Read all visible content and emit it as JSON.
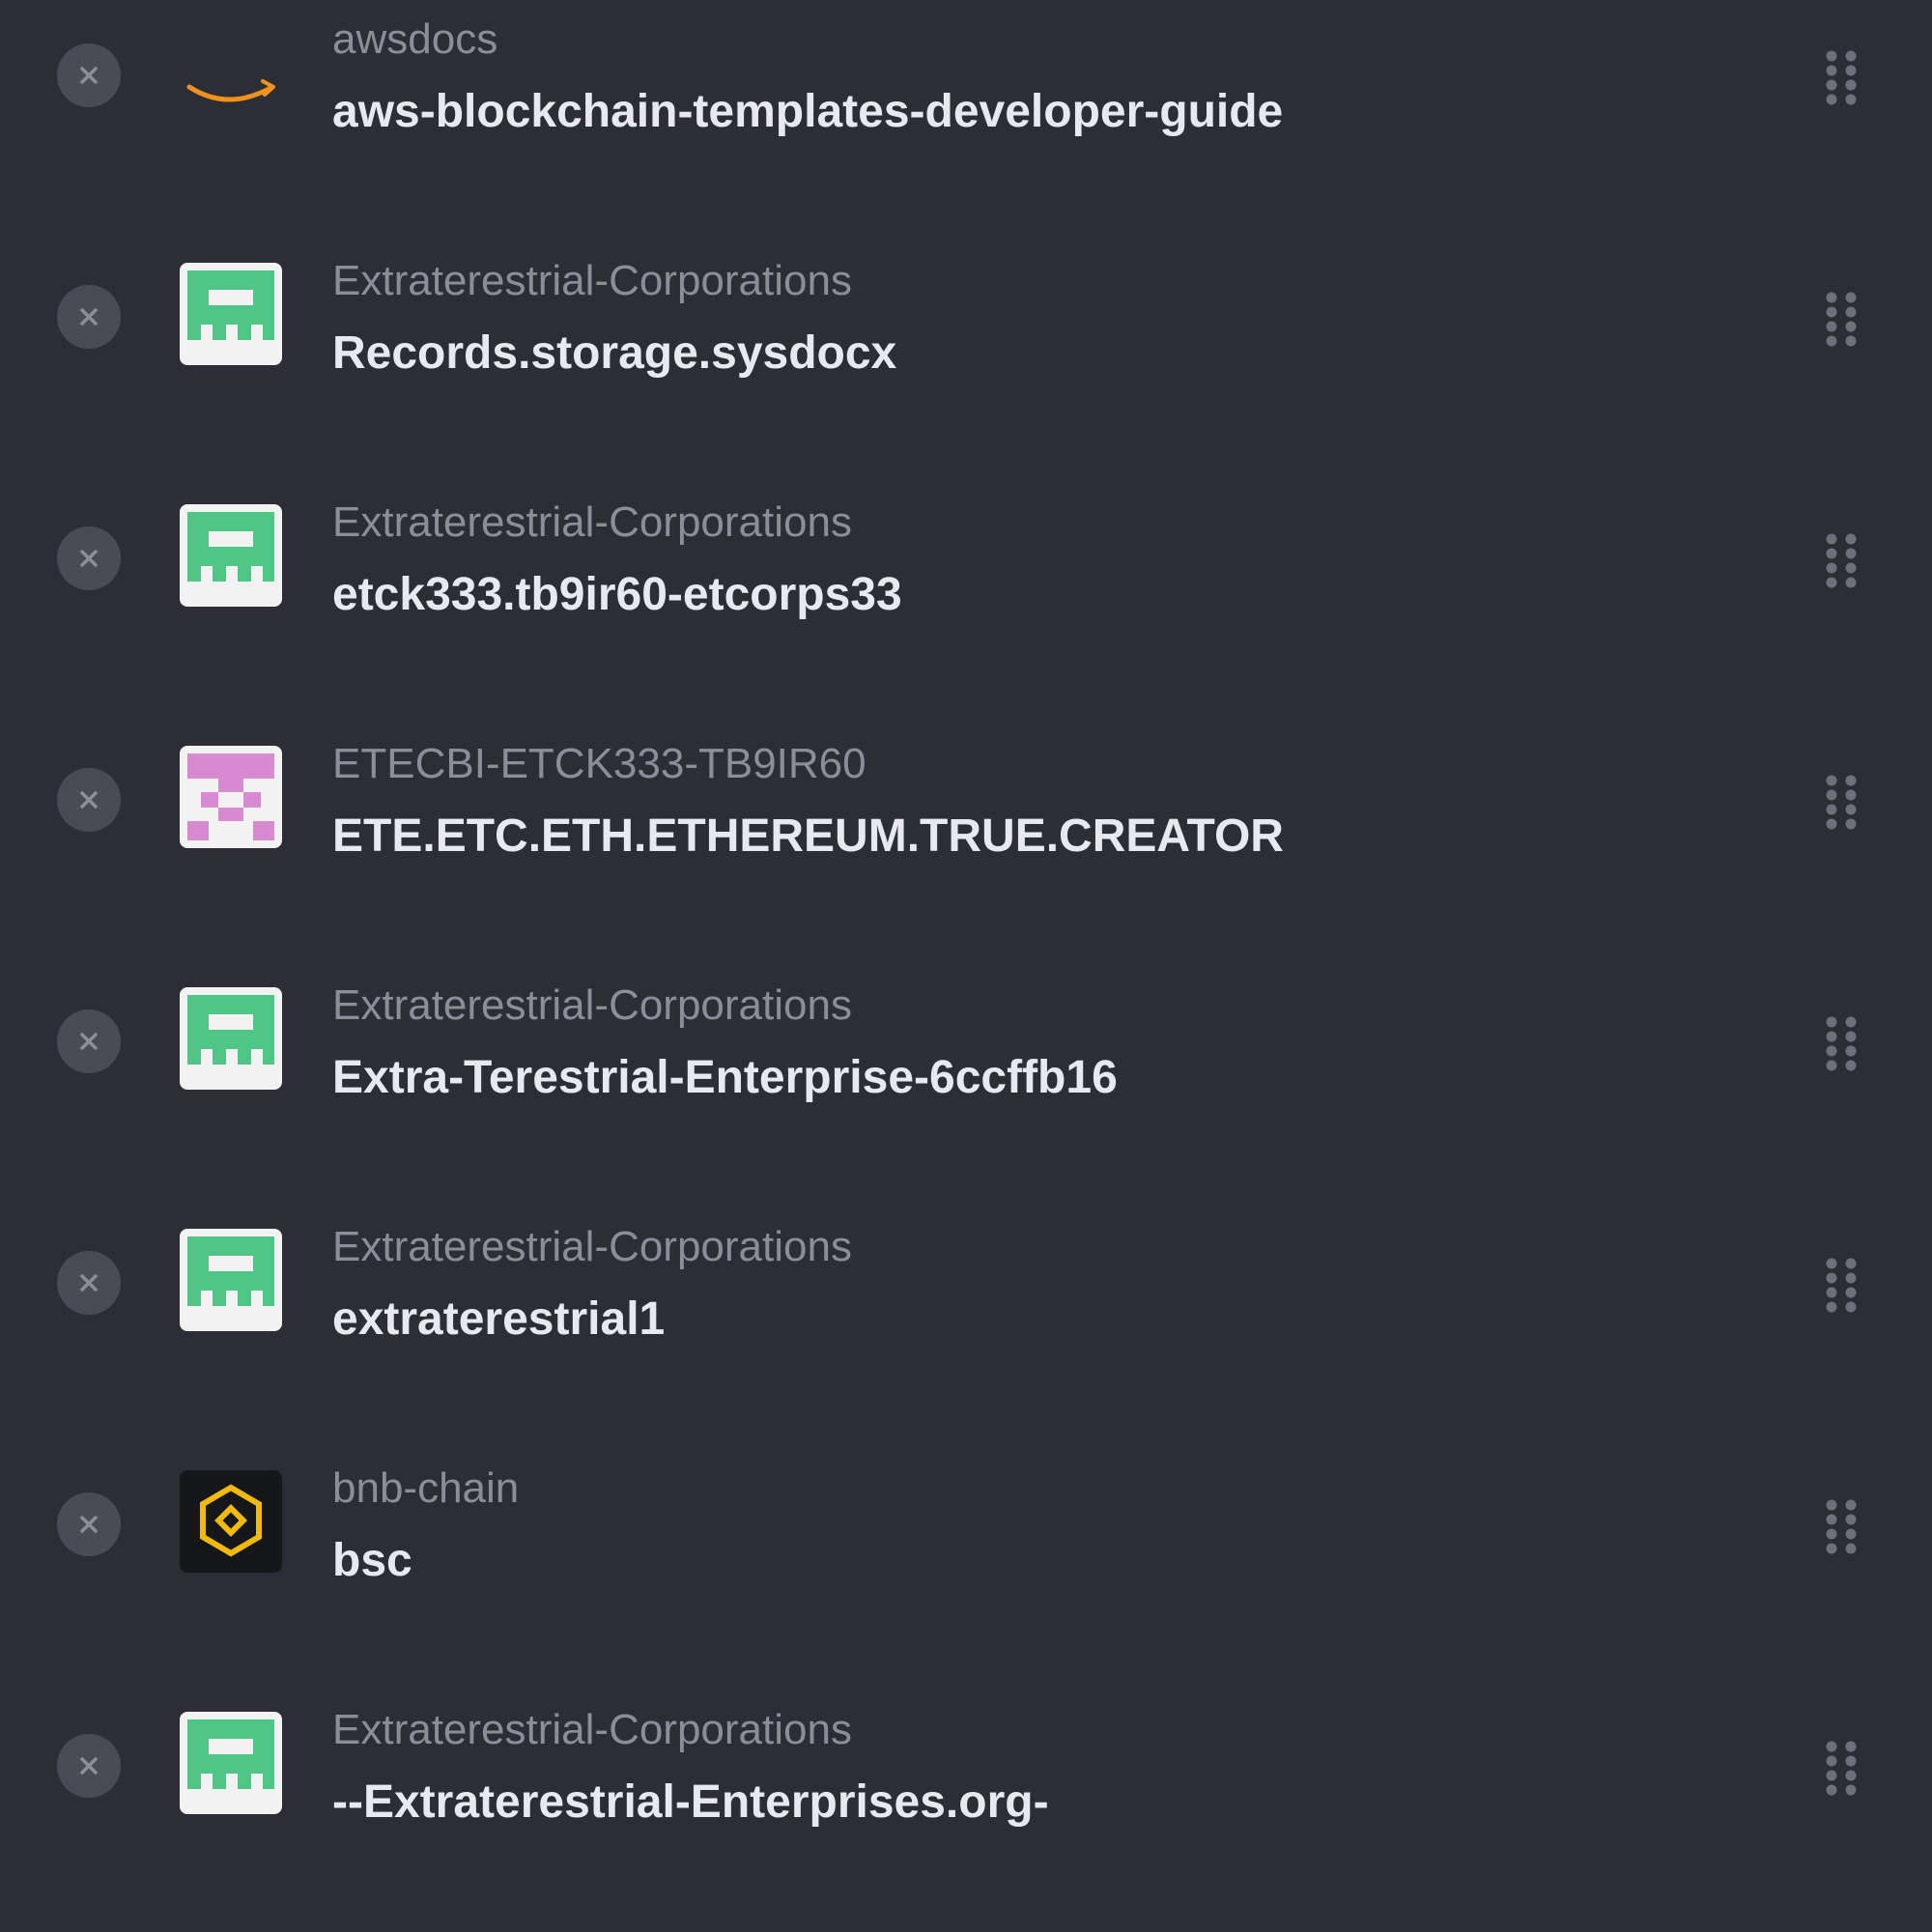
{
  "pinned_repos": [
    {
      "owner": "awsdocs",
      "name": "aws-blockchain-templates-developer-guide",
      "avatar": "amazon-logo-icon"
    },
    {
      "owner": "Extraterestrial-Corporations",
      "name": "Records.storage.sysdocx",
      "avatar": "green-identicon"
    },
    {
      "owner": "Extraterestrial-Corporations",
      "name": "etck333.tb9ir60-etcorps33",
      "avatar": "green-identicon"
    },
    {
      "owner": "ETECBI-ETCK333-TB9IR60",
      "name": "ETE.ETC.ETH.ETHEREUM.TRUE.CREATOR",
      "avatar": "pink-identicon"
    },
    {
      "owner": "Extraterestrial-Corporations",
      "name": "Extra-Terestrial-Enterprise-6ccffb16",
      "avatar": "green-identicon"
    },
    {
      "owner": "Extraterestrial-Corporations",
      "name": "extraterestrial1",
      "avatar": "green-identicon"
    },
    {
      "owner": "bnb-chain",
      "name": "bsc",
      "avatar": "bnb-chain-logo-icon"
    },
    {
      "owner": "Extraterestrial-Corporations",
      "name": "--Extraterestrial-Enterprises.org-",
      "avatar": "green-identicon"
    }
  ],
  "colors": {
    "background": "#2d2e35",
    "owner_text": "#8c8d97",
    "repo_text": "#e8e9ee",
    "remove_button": "#4a4b54",
    "green_identicon": "#4fc685",
    "pink_identicon": "#d88ad0",
    "amazon_orange": "#f0931e",
    "bnb_yellow": "#f0b90b"
  }
}
